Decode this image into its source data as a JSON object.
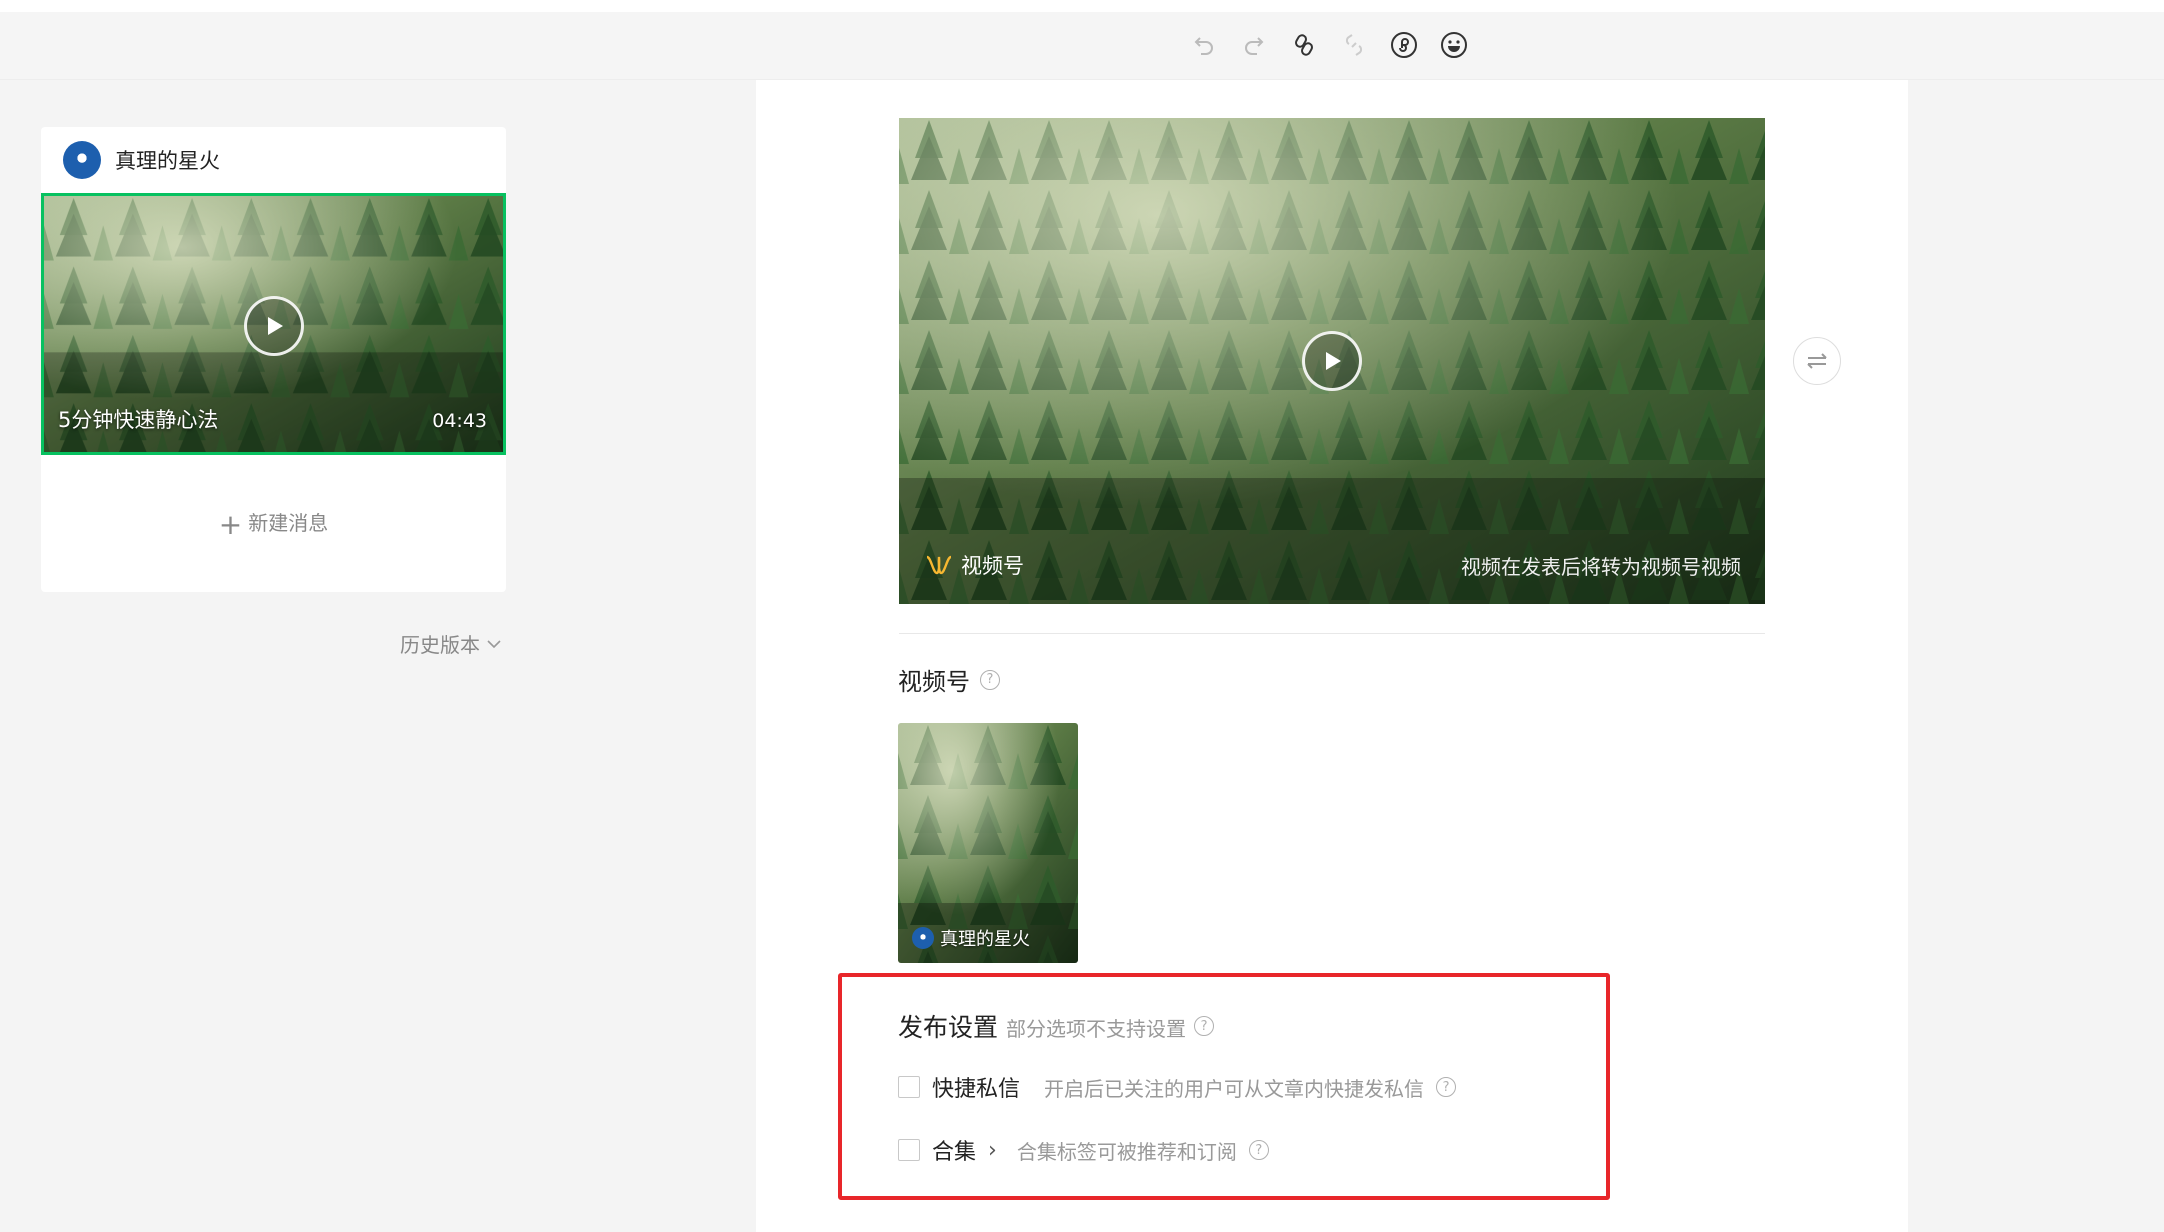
{
  "toolbar": {
    "icons": [
      "undo-icon",
      "redo-icon",
      "link-icon",
      "unlink-icon",
      "mini-program-icon",
      "emoji-icon"
    ]
  },
  "account": {
    "name": "真理的星火"
  },
  "message": {
    "title": "5分钟快速静心法",
    "duration": "04:43"
  },
  "new_message": {
    "label": "新建消息"
  },
  "history": {
    "label": "历史版本"
  },
  "video": {
    "brand": "视频号",
    "note": "视频在发表后将转为视频号视频"
  },
  "channel": {
    "section_title": "视频号",
    "card_name": "真理的星火"
  },
  "publish_settings": {
    "title": "发布设置",
    "subtitle": "部分选项不支持设置",
    "options": [
      {
        "label": "快捷私信",
        "desc": "开启后已关注的用户可从文章内快捷发私信",
        "checked": false
      },
      {
        "label": "合集",
        "desc": "合集标签可被推荐和订阅",
        "checked": false
      }
    ]
  },
  "colors": {
    "selected_border": "#07c160",
    "highlight_box": "#e8262a"
  }
}
